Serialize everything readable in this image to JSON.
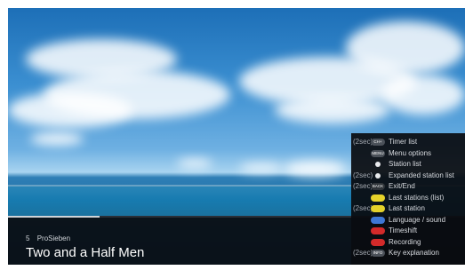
{
  "program": {
    "channel_number": "5",
    "channel_name": "ProSieben",
    "title": "Two and a Half Men",
    "progress": 0.2
  },
  "help_panel": {
    "rows": [
      {
        "sec": "(2sec)",
        "key": "CH+",
        "key_color": "#4b5159",
        "label": "Timer list"
      },
      {
        "sec": "",
        "key": "MENU",
        "key_color": "#4b5159",
        "label": "Menu options"
      },
      {
        "sec": "",
        "key": "",
        "key_color": "#e8eaed",
        "label": "Station list"
      },
      {
        "sec": "(2sec)",
        "key": "",
        "key_color": "#e8eaed",
        "label": "Expanded station list"
      },
      {
        "sec": "(2sec)",
        "key": "BACK",
        "key_color": "#2f3439",
        "label": "Exit/End"
      },
      {
        "sec": "",
        "key": "",
        "key_color": "#e4d12a",
        "label": "Last stations (list)"
      },
      {
        "sec": "(2sec)",
        "key": "",
        "key_color": "#e4d12a",
        "label": "Last station"
      },
      {
        "sec": "",
        "key": "",
        "key_color": "#3e77d5",
        "label": "Language / sound"
      },
      {
        "sec": "",
        "key": "",
        "key_color": "#d32a2a",
        "label": "Timeshift"
      },
      {
        "sec": "",
        "key": "",
        "key_color": "#d32a2a",
        "label": "Recording"
      },
      {
        "sec": "(2sec)",
        "key": "INFO",
        "key_color": "#4b5159",
        "label": "Key explanation"
      }
    ]
  }
}
